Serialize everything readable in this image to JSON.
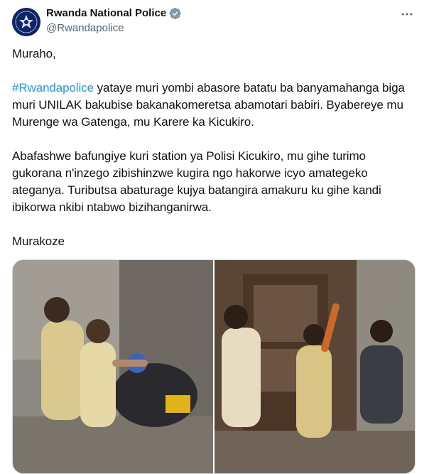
{
  "author": {
    "display_name": "Rwanda National Police",
    "handle": "@Rwandapolice",
    "verified": true,
    "avatar_icon": "police-badge-icon"
  },
  "tweet": {
    "greeting": "Muraho,",
    "paragraph1_hashtag": "#Rwandapolice",
    "paragraph1_text": " yataye muri yombi abasore batatu ba banyamahanga biga muri UNILAK bakubise bakanakomeretsa abamotari babiri. Byabereye mu Murenge wa Gatenga, mu Karere ka Kicukiro.",
    "paragraph2": "Abafashwe bafungiye kuri station ya Polisi Kicukiro, mu gihe turimo gukorana n'inzego zibishinzwe kugira ngo hakorwe icyo amategeko ateganya. Tuributsa abaturage kujya batangira amakuru ku gihe kandi ibikorwa nkibi ntabwo bizihanganirwa.",
    "closing": "Murakoze"
  },
  "icons": {
    "more": "more-options-icon",
    "verified": "verified-badge-icon"
  },
  "colors": {
    "link": "#1d9bf0",
    "text": "#0f1419",
    "secondary": "#536471",
    "verified": "#829aab"
  }
}
